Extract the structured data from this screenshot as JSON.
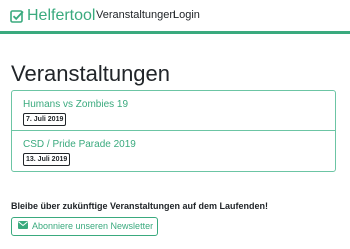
{
  "nav": {
    "brand": "Helfertool",
    "brand_icon": "checkbox-icon",
    "links": [
      "Veranstaltungen",
      "Login"
    ]
  },
  "page": {
    "title": "Veranstaltungen"
  },
  "events": [
    {
      "title": "Humans vs Zombies 19",
      "date": "7. Juli 2019"
    },
    {
      "title": "CSD / Pride Parade 2019",
      "date": "13. Juli 2019"
    }
  ],
  "newsletter": {
    "text": "Bleibe über zukünftige Veranstaltungen auf dem Laufenden!",
    "button_label": "Abonniere unseren Newsletter",
    "button_icon": "envelope-icon"
  },
  "colors": {
    "accent": "#3aaa7e",
    "border": "#6cc5a4"
  }
}
